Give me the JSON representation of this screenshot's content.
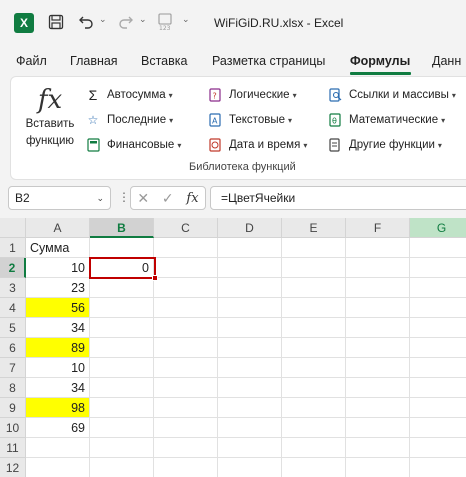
{
  "title_bar": {
    "app_letter": "X",
    "document_title": "WiFiGiD.RU.xlsx  -  Excel"
  },
  "tabs": [
    {
      "label": "Файл"
    },
    {
      "label": "Главная"
    },
    {
      "label": "Вставка"
    },
    {
      "label": "Разметка страницы"
    },
    {
      "label": "Формулы",
      "active": true
    },
    {
      "label": "Данн"
    }
  ],
  "ribbon": {
    "insert_function": {
      "icon": "fx-icon",
      "label_line1": "Вставить",
      "label_line2": "функцию"
    },
    "buttons": [
      {
        "label": "Автосумма",
        "icon": "sigma-icon"
      },
      {
        "label": "Последние",
        "icon": "star-icon"
      },
      {
        "label": "Финансовые",
        "icon": "calculator-icon"
      },
      {
        "label": "Логические",
        "icon": "question-book-icon"
      },
      {
        "label": "Текстовые",
        "icon": "text-book-icon"
      },
      {
        "label": "Дата и время",
        "icon": "clock-book-icon"
      },
      {
        "label": "Ссылки и массивы",
        "icon": "search-book-icon"
      },
      {
        "label": "Математические",
        "icon": "math-book-icon"
      },
      {
        "label": "Другие функции",
        "icon": "more-functions-icon"
      }
    ],
    "group_label": "Библиотека функций"
  },
  "formula_bar": {
    "name_box": "B2",
    "formula": "=ЦветЯчейки"
  },
  "colors": {
    "accent": "#107c41",
    "highlight": "#ffff00",
    "active_cell_border": "#c00000"
  },
  "grid": {
    "columns": [
      "A",
      "B",
      "C",
      "D",
      "E",
      "F",
      "G"
    ],
    "selected_column": "B",
    "selected_row": "2",
    "rows": [
      {
        "num": "1",
        "a": "Сумма",
        "b": "",
        "yellow": false
      },
      {
        "num": "2",
        "a": "10",
        "b": "0",
        "yellow": false
      },
      {
        "num": "3",
        "a": "23",
        "b": "",
        "yellow": false
      },
      {
        "num": "4",
        "a": "56",
        "b": "",
        "yellow": true
      },
      {
        "num": "5",
        "a": "34",
        "b": "",
        "yellow": false
      },
      {
        "num": "6",
        "a": "89",
        "b": "",
        "yellow": true
      },
      {
        "num": "7",
        "a": "10",
        "b": "",
        "yellow": false
      },
      {
        "num": "8",
        "a": "34",
        "b": "",
        "yellow": false
      },
      {
        "num": "9",
        "a": "98",
        "b": "",
        "yellow": true
      },
      {
        "num": "10",
        "a": "69",
        "b": "",
        "yellow": false
      },
      {
        "num": "11",
        "a": "",
        "b": "",
        "yellow": false
      },
      {
        "num": "12",
        "a": "",
        "b": "",
        "yellow": false
      }
    ]
  }
}
